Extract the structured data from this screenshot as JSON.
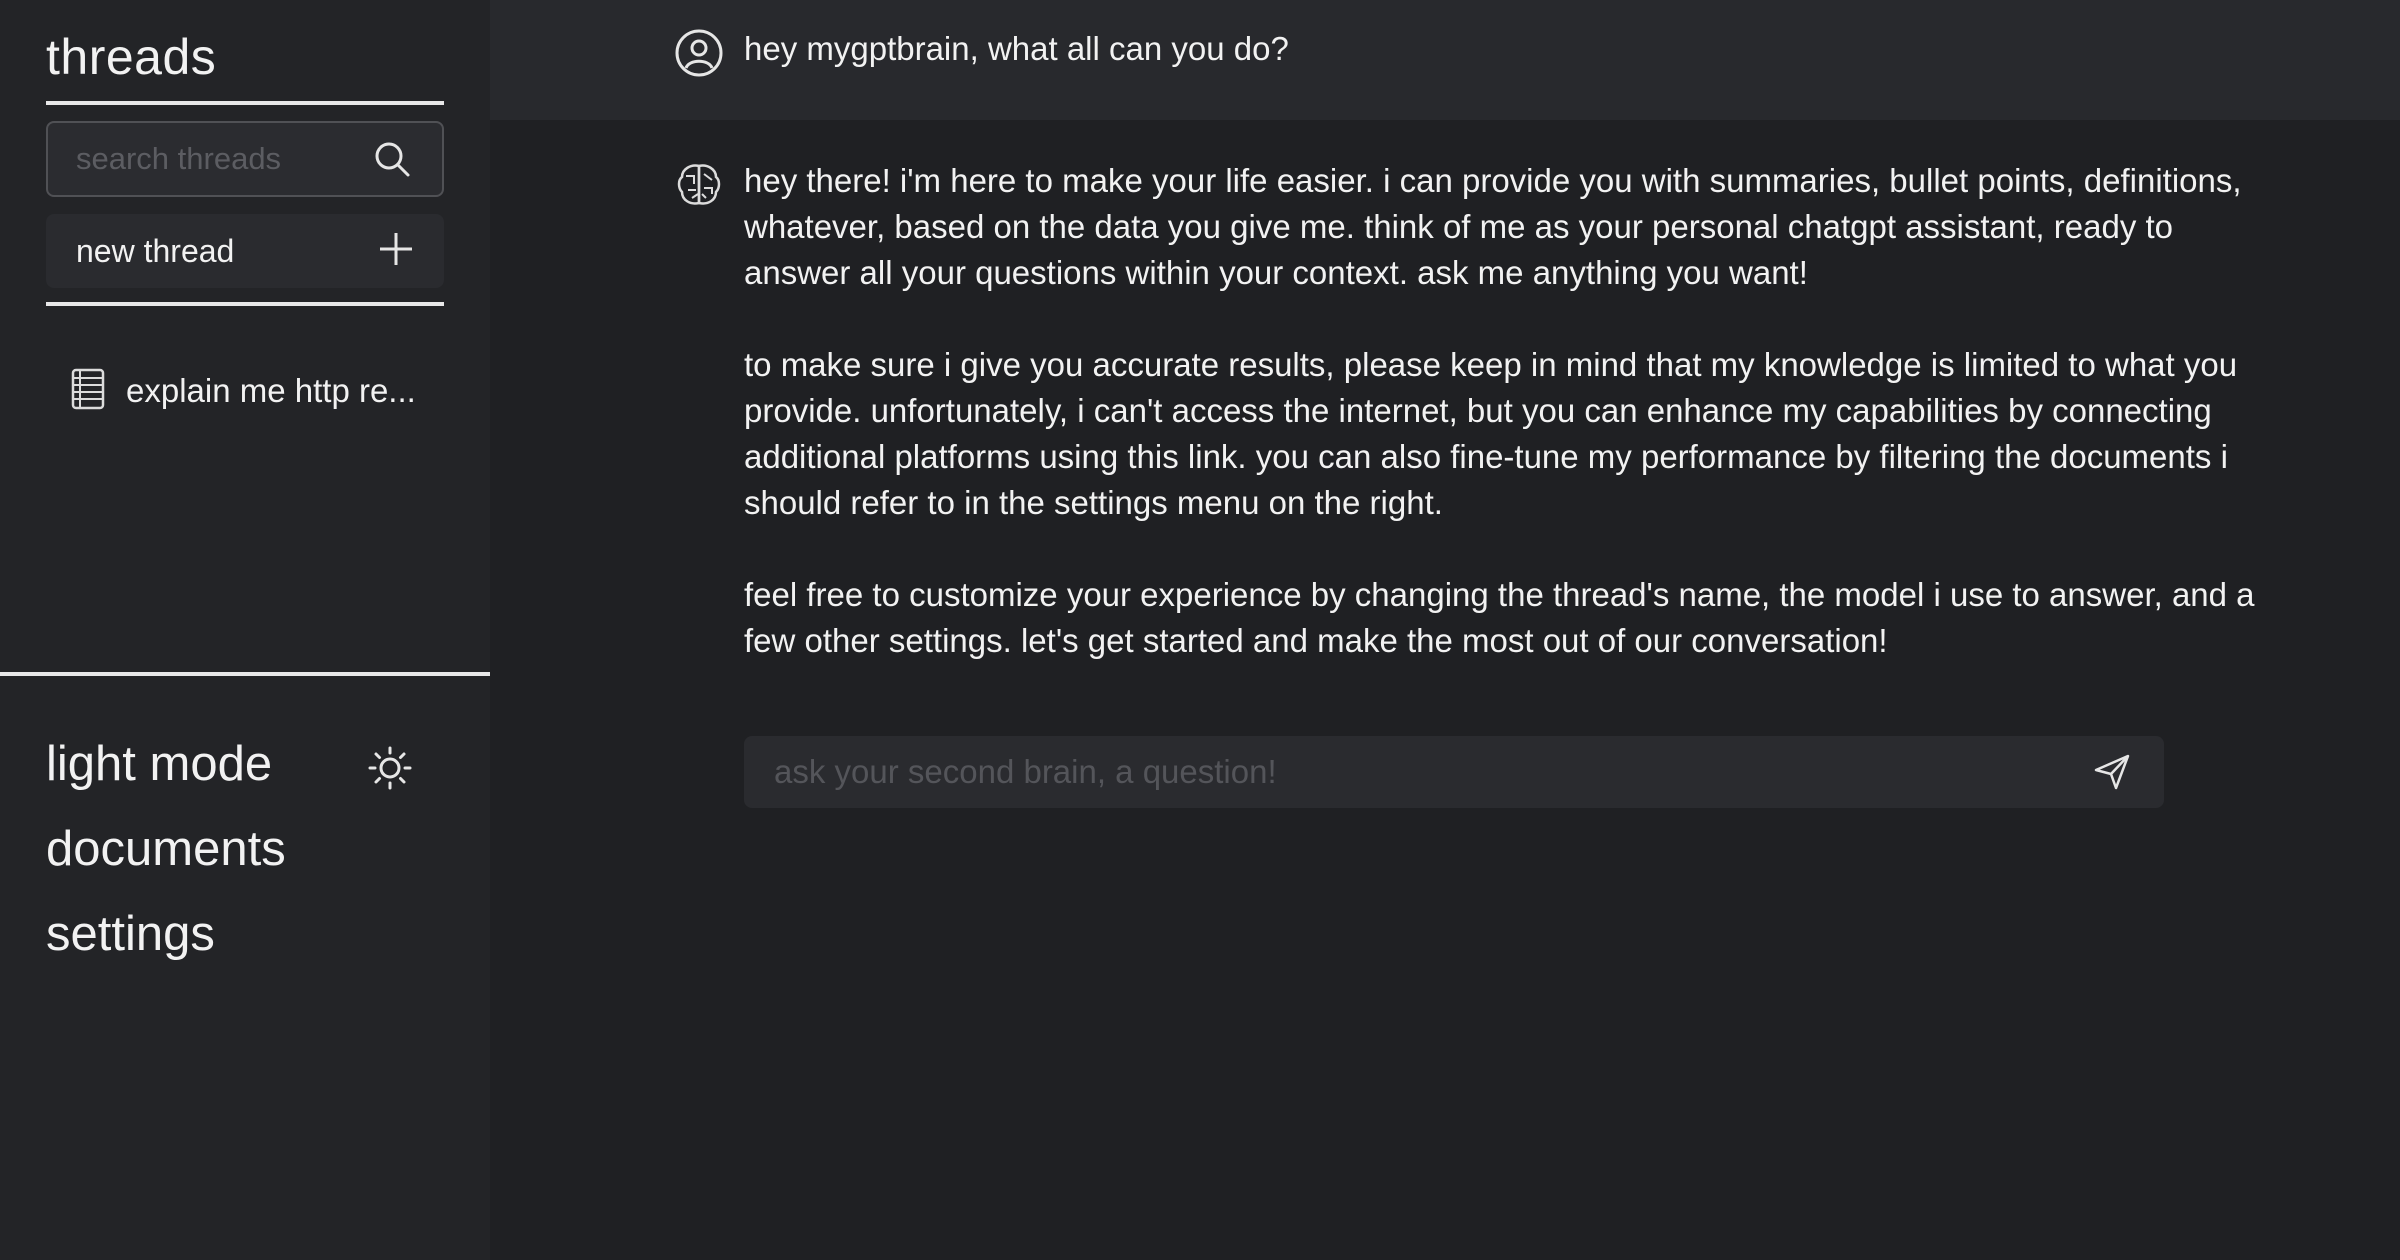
{
  "sidebar": {
    "title": "threads",
    "search": {
      "placeholder": "search threads",
      "icon": "search-icon"
    },
    "new_thread": {
      "label": "new thread",
      "icon": "plus-icon"
    },
    "threads": [
      {
        "label": "explain me http re...",
        "icon": "document-stack-icon"
      }
    ],
    "menu": {
      "light_mode": {
        "label": "light mode",
        "icon": "sun-icon"
      },
      "documents": {
        "label": "documents"
      },
      "settings": {
        "label": "settings"
      }
    }
  },
  "conversation": {
    "user_message": {
      "text": "hey mygptbrain, what all can you do?",
      "icon": "user-avatar-icon"
    },
    "bot_message": {
      "icon": "brain-icon",
      "paragraphs": [
        "hey there! i'm here to make your life easier. i can provide you with summaries, bullet points, definitions, whatever, based on the data you give me. think of me as your personal chatgpt assistant, ready to answer all your questions within your context. ask me anything you want!",
        "to make sure i give you accurate results, please keep in mind that my knowledge is limited to what you provide. unfortunately, i can't access the internet, but you can enhance my capabilities by connecting additional platforms using this link. you can also fine-tune my performance by filtering the documents i should refer to in the settings menu on the right.",
        "feel free to customize your experience by changing the thread's name, the model i use to answer, and a few other settings. let's get started and make the most out of our conversation!"
      ]
    }
  },
  "composer": {
    "placeholder": "ask your second brain, a question!",
    "icon": "send-icon"
  },
  "colors": {
    "background": "#1f2023",
    "sidebar": "#232427",
    "user_row": "#28292d",
    "text": "#f2f2f2",
    "placeholder": "#5c5d62"
  }
}
